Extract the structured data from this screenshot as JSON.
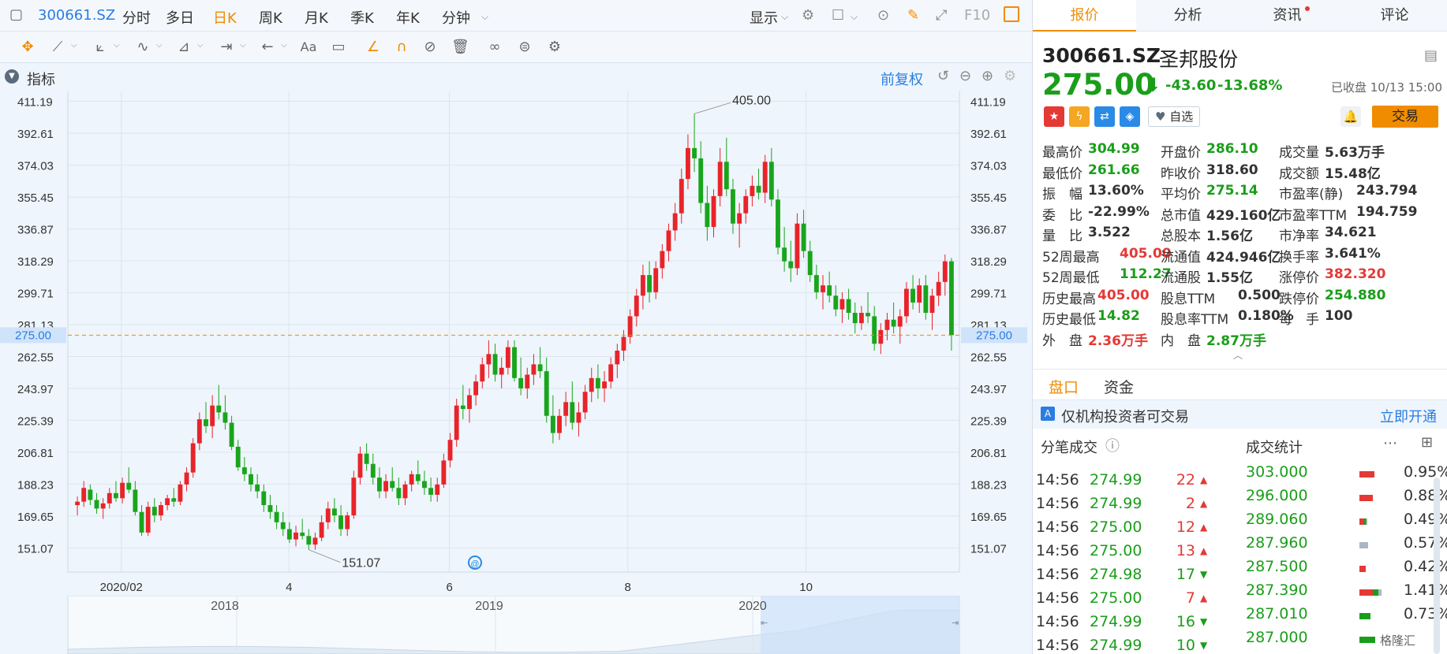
{
  "topbar": {
    "code": "300661.SZ",
    "periods": [
      "分时",
      "多日",
      "日K",
      "周K",
      "月K",
      "季K",
      "年K",
      "分钟"
    ],
    "active_period": "日K",
    "display_label": "显示",
    "f10_label": "F10"
  },
  "indicator": {
    "label": "指标",
    "fuquan": "前复权"
  },
  "chart_data": {
    "type": "candlestick",
    "y_ticks": [
      411.19,
      392.61,
      374.03,
      355.45,
      336.87,
      318.29,
      299.71,
      281.13,
      262.55,
      243.97,
      225.39,
      206.81,
      188.23,
      169.65,
      151.07
    ],
    "ylim": [
      137,
      417
    ],
    "x_tick_labels": [
      "2020/02",
      "4",
      "6",
      "8",
      "10"
    ],
    "current_price_label": "275.00",
    "high_marker": "405.00",
    "low_marker": "151.07",
    "navigator_years": [
      "2018",
      "2019",
      "2020"
    ],
    "ohlc": [
      [
        176,
        181,
        170,
        178
      ],
      [
        178,
        190,
        175,
        186
      ],
      [
        185,
        188,
        176,
        179
      ],
      [
        179,
        183,
        171,
        174
      ],
      [
        174,
        180,
        168,
        177
      ],
      [
        177,
        186,
        174,
        183
      ],
      [
        183,
        190,
        178,
        180
      ],
      [
        180,
        192,
        177,
        189
      ],
      [
        189,
        198,
        183,
        185
      ],
      [
        185,
        190,
        170,
        172
      ],
      [
        172,
        176,
        158,
        160
      ],
      [
        160,
        178,
        158,
        175
      ],
      [
        175,
        180,
        166,
        170
      ],
      [
        170,
        178,
        167,
        176
      ],
      [
        176,
        182,
        173,
        180
      ],
      [
        180,
        186,
        175,
        178
      ],
      [
        178,
        190,
        176,
        188
      ],
      [
        188,
        198,
        184,
        195
      ],
      [
        195,
        215,
        192,
        212
      ],
      [
        212,
        230,
        208,
        226
      ],
      [
        226,
        236,
        218,
        222
      ],
      [
        222,
        240,
        215,
        234
      ],
      [
        234,
        246,
        226,
        230
      ],
      [
        230,
        240,
        220,
        224
      ],
      [
        224,
        228,
        208,
        210
      ],
      [
        210,
        214,
        196,
        198
      ],
      [
        198,
        204,
        190,
        194
      ],
      [
        194,
        198,
        184,
        188
      ],
      [
        188,
        194,
        180,
        184
      ],
      [
        184,
        188,
        172,
        176
      ],
      [
        176,
        182,
        168,
        172
      ],
      [
        172,
        176,
        162,
        166
      ],
      [
        166,
        172,
        158,
        162
      ],
      [
        162,
        166,
        154,
        156
      ],
      [
        156,
        164,
        152,
        160
      ],
      [
        160,
        168,
        156,
        158
      ],
      [
        158,
        162,
        150,
        153
      ],
      [
        153,
        160,
        150,
        157
      ],
      [
        157,
        170,
        155,
        166
      ],
      [
        166,
        178,
        162,
        174
      ],
      [
        174,
        180,
        166,
        170
      ],
      [
        170,
        176,
        158,
        162
      ],
      [
        162,
        172,
        158,
        170
      ],
      [
        170,
        196,
        168,
        192
      ],
      [
        192,
        210,
        188,
        206
      ],
      [
        206,
        212,
        196,
        200
      ],
      [
        200,
        206,
        188,
        192
      ],
      [
        192,
        198,
        180,
        184
      ],
      [
        184,
        194,
        180,
        190
      ],
      [
        190,
        198,
        184,
        186
      ],
      [
        186,
        192,
        176,
        180
      ],
      [
        180,
        190,
        176,
        188
      ],
      [
        188,
        196,
        184,
        194
      ],
      [
        194,
        202,
        188,
        190
      ],
      [
        190,
        196,
        182,
        186
      ],
      [
        186,
        192,
        178,
        182
      ],
      [
        182,
        192,
        178,
        188
      ],
      [
        188,
        206,
        186,
        202
      ],
      [
        202,
        218,
        198,
        214
      ],
      [
        214,
        238,
        210,
        234
      ],
      [
        234,
        246,
        226,
        232
      ],
      [
        232,
        244,
        224,
        240
      ],
      [
        240,
        252,
        234,
        248
      ],
      [
        248,
        262,
        244,
        258
      ],
      [
        258,
        272,
        250,
        264
      ],
      [
        264,
        270,
        248,
        252
      ],
      [
        252,
        262,
        244,
        256
      ],
      [
        256,
        272,
        252,
        268
      ],
      [
        268,
        272,
        248,
        250
      ],
      [
        250,
        262,
        240,
        244
      ],
      [
        244,
        256,
        238,
        252
      ],
      [
        252,
        264,
        246,
        258
      ],
      [
        258,
        268,
        250,
        254
      ],
      [
        254,
        262,
        224,
        228
      ],
      [
        228,
        240,
        212,
        218
      ],
      [
        218,
        232,
        214,
        228
      ],
      [
        228,
        242,
        222,
        236
      ],
      [
        236,
        248,
        220,
        224
      ],
      [
        224,
        236,
        216,
        230
      ],
      [
        230,
        246,
        226,
        242
      ],
      [
        242,
        256,
        236,
        250
      ],
      [
        250,
        258,
        238,
        244
      ],
      [
        244,
        254,
        236,
        248
      ],
      [
        248,
        262,
        244,
        258
      ],
      [
        258,
        270,
        250,
        266
      ],
      [
        266,
        278,
        260,
        274
      ],
      [
        274,
        290,
        270,
        286
      ],
      [
        286,
        302,
        280,
        298
      ],
      [
        298,
        316,
        290,
        310
      ],
      [
        310,
        318,
        294,
        300
      ],
      [
        300,
        318,
        296,
        314
      ],
      [
        314,
        328,
        308,
        324
      ],
      [
        324,
        340,
        318,
        336
      ],
      [
        336,
        352,
        330,
        346
      ],
      [
        346,
        372,
        340,
        366
      ],
      [
        366,
        392,
        360,
        384
      ],
      [
        384,
        404,
        370,
        378
      ],
      [
        378,
        388,
        346,
        352
      ],
      [
        352,
        362,
        330,
        338
      ],
      [
        338,
        360,
        332,
        356
      ],
      [
        356,
        384,
        350,
        376
      ],
      [
        376,
        390,
        356,
        360
      ],
      [
        360,
        366,
        334,
        340
      ],
      [
        340,
        352,
        326,
        346
      ],
      [
        346,
        360,
        340,
        356
      ],
      [
        356,
        368,
        350,
        362
      ],
      [
        362,
        372,
        354,
        358
      ],
      [
        358,
        380,
        352,
        376
      ],
      [
        376,
        384,
        350,
        354
      ],
      [
        354,
        360,
        322,
        326
      ],
      [
        326,
        338,
        312,
        318
      ],
      [
        318,
        330,
        306,
        314
      ],
      [
        314,
        346,
        310,
        340
      ],
      [
        340,
        348,
        320,
        324
      ],
      [
        324,
        330,
        306,
        310
      ],
      [
        310,
        316,
        296,
        300
      ],
      [
        300,
        310,
        290,
        304
      ],
      [
        304,
        312,
        294,
        298
      ],
      [
        298,
        304,
        286,
        290
      ],
      [
        290,
        300,
        282,
        296
      ],
      [
        296,
        302,
        284,
        288
      ],
      [
        288,
        294,
        276,
        282
      ],
      [
        282,
        292,
        278,
        288
      ],
      [
        288,
        300,
        282,
        286
      ],
      [
        286,
        292,
        266,
        270
      ],
      [
        270,
        282,
        264,
        278
      ],
      [
        278,
        288,
        272,
        284
      ],
      [
        284,
        294,
        276,
        280
      ],
      [
        280,
        290,
        270,
        286
      ],
      [
        286,
        306,
        282,
        302
      ],
      [
        302,
        310,
        290,
        294
      ],
      [
        294,
        308,
        288,
        304
      ],
      [
        304,
        310,
        284,
        288
      ],
      [
        288,
        302,
        278,
        298
      ],
      [
        298,
        312,
        292,
        306
      ],
      [
        306,
        322,
        298,
        318
      ],
      [
        318,
        320,
        266,
        275
      ]
    ]
  },
  "quote": {
    "code": "300661.SZ",
    "name": "圣邦股份",
    "price": "275.00",
    "change": "-43.60",
    "change_pct": "-13.68%",
    "status": "已收盘 10/13 15:00",
    "watch_label": "自选",
    "trade_label": "交易",
    "stats": [
      [
        {
          "label": "最高价",
          "value": "304.99",
          "color": "down"
        },
        {
          "label": "开盘价",
          "value": "286.10",
          "color": "down"
        },
        {
          "label": "成交量",
          "value": "5.63万手",
          "color": "normal"
        }
      ],
      [
        {
          "label": "最低价",
          "value": "261.66",
          "color": "down"
        },
        {
          "label": "昨收价",
          "value": "318.60",
          "color": "normal"
        },
        {
          "label": "成交额",
          "value": "15.48亿",
          "color": "normal"
        }
      ],
      [
        {
          "label": "振　幅",
          "value": "13.60%",
          "color": "normal"
        },
        {
          "label": "平均价",
          "value": "275.14",
          "color": "down"
        },
        {
          "label": "市盈率(静)",
          "value": "243.794",
          "color": "normal"
        }
      ],
      [
        {
          "label": "委　比",
          "value": "-22.99%",
          "color": "normal"
        },
        {
          "label": "总市值",
          "value": "429.160亿",
          "color": "normal"
        },
        {
          "label": "市盈率TTM",
          "value": "194.759",
          "color": "normal"
        }
      ],
      [
        {
          "label": "量　比",
          "value": "3.522",
          "color": "normal"
        },
        {
          "label": "总股本",
          "value": "1.56亿",
          "color": "normal"
        },
        {
          "label": "市净率",
          "value": "34.621",
          "color": "normal"
        }
      ],
      [
        {
          "label": "52周最高",
          "value": "405.00",
          "color": "up"
        },
        {
          "label": "流通值",
          "value": "424.946亿",
          "color": "normal"
        },
        {
          "label": "换手率",
          "value": "3.641%",
          "color": "normal"
        }
      ],
      [
        {
          "label": "52周最低",
          "value": "112.27",
          "color": "down"
        },
        {
          "label": "流通股",
          "value": "1.55亿",
          "color": "normal"
        },
        {
          "label": "涨停价",
          "value": "382.320",
          "color": "up"
        }
      ],
      [
        {
          "label": "历史最高",
          "value": "405.00",
          "color": "up"
        },
        {
          "label": "股息TTM",
          "value": "0.500",
          "color": "normal"
        },
        {
          "label": "跌停价",
          "value": "254.880",
          "color": "down"
        }
      ],
      [
        {
          "label": "历史最低",
          "value": "14.82",
          "color": "down"
        },
        {
          "label": "股息率TTM",
          "value": "0.180%",
          "color": "normal"
        },
        {
          "label": "每　手",
          "value": "100",
          "color": "normal"
        }
      ],
      [
        {
          "label": "外　盘",
          "value": "2.36万手",
          "color": "up"
        },
        {
          "label": "内　盘",
          "value": "2.87万手",
          "color": "down"
        },
        {
          "label": "",
          "value": "",
          "color": "normal"
        }
      ]
    ]
  },
  "right_tabs": [
    "报价",
    "分析",
    "资讯",
    "评论"
  ],
  "subtabs": [
    "盘口",
    "资金"
  ],
  "banner": {
    "text": "仅机构投资者可交易",
    "link": "立即开通"
  },
  "ticks_title": "分笔成交",
  "stats_title": "成交统计",
  "ticks": [
    {
      "time": "14:56",
      "price": "274.99",
      "vol": "22",
      "dir": "up"
    },
    {
      "time": "14:56",
      "price": "274.99",
      "vol": "2",
      "dir": "up"
    },
    {
      "time": "14:56",
      "price": "275.00",
      "vol": "12",
      "dir": "up"
    },
    {
      "time": "14:56",
      "price": "275.00",
      "vol": "13",
      "dir": "up"
    },
    {
      "time": "14:56",
      "price": "274.98",
      "vol": "17",
      "dir": "down"
    },
    {
      "time": "14:56",
      "price": "275.00",
      "vol": "7",
      "dir": "up"
    },
    {
      "time": "14:56",
      "price": "274.99",
      "vol": "16",
      "dir": "down"
    },
    {
      "time": "14:56",
      "price": "274.99",
      "vol": "10",
      "dir": "down"
    }
  ],
  "trade_stats": [
    {
      "price": "303.000",
      "pct": "0.95%",
      "bar": "red",
      "frac": 0.95
    },
    {
      "price": "296.000",
      "pct": "0.88%",
      "bar": "red",
      "frac": 0.88
    },
    {
      "price": "289.060",
      "pct": "0.49%",
      "bar": "mix",
      "frac": 0.49
    },
    {
      "price": "287.960",
      "pct": "0.57%",
      "bar": "gray",
      "frac": 0.57
    },
    {
      "price": "287.500",
      "pct": "0.42%",
      "bar": "red",
      "frac": 0.42
    },
    {
      "price": "287.390",
      "pct": "1.41%",
      "bar": "mix",
      "frac": 1.41
    },
    {
      "price": "287.010",
      "pct": "0.73%",
      "bar": "green",
      "frac": 0.73
    },
    {
      "price": "287.000",
      "pct": "",
      "bar": "green",
      "frac": 1.0
    }
  ],
  "watermark": "格隆汇"
}
